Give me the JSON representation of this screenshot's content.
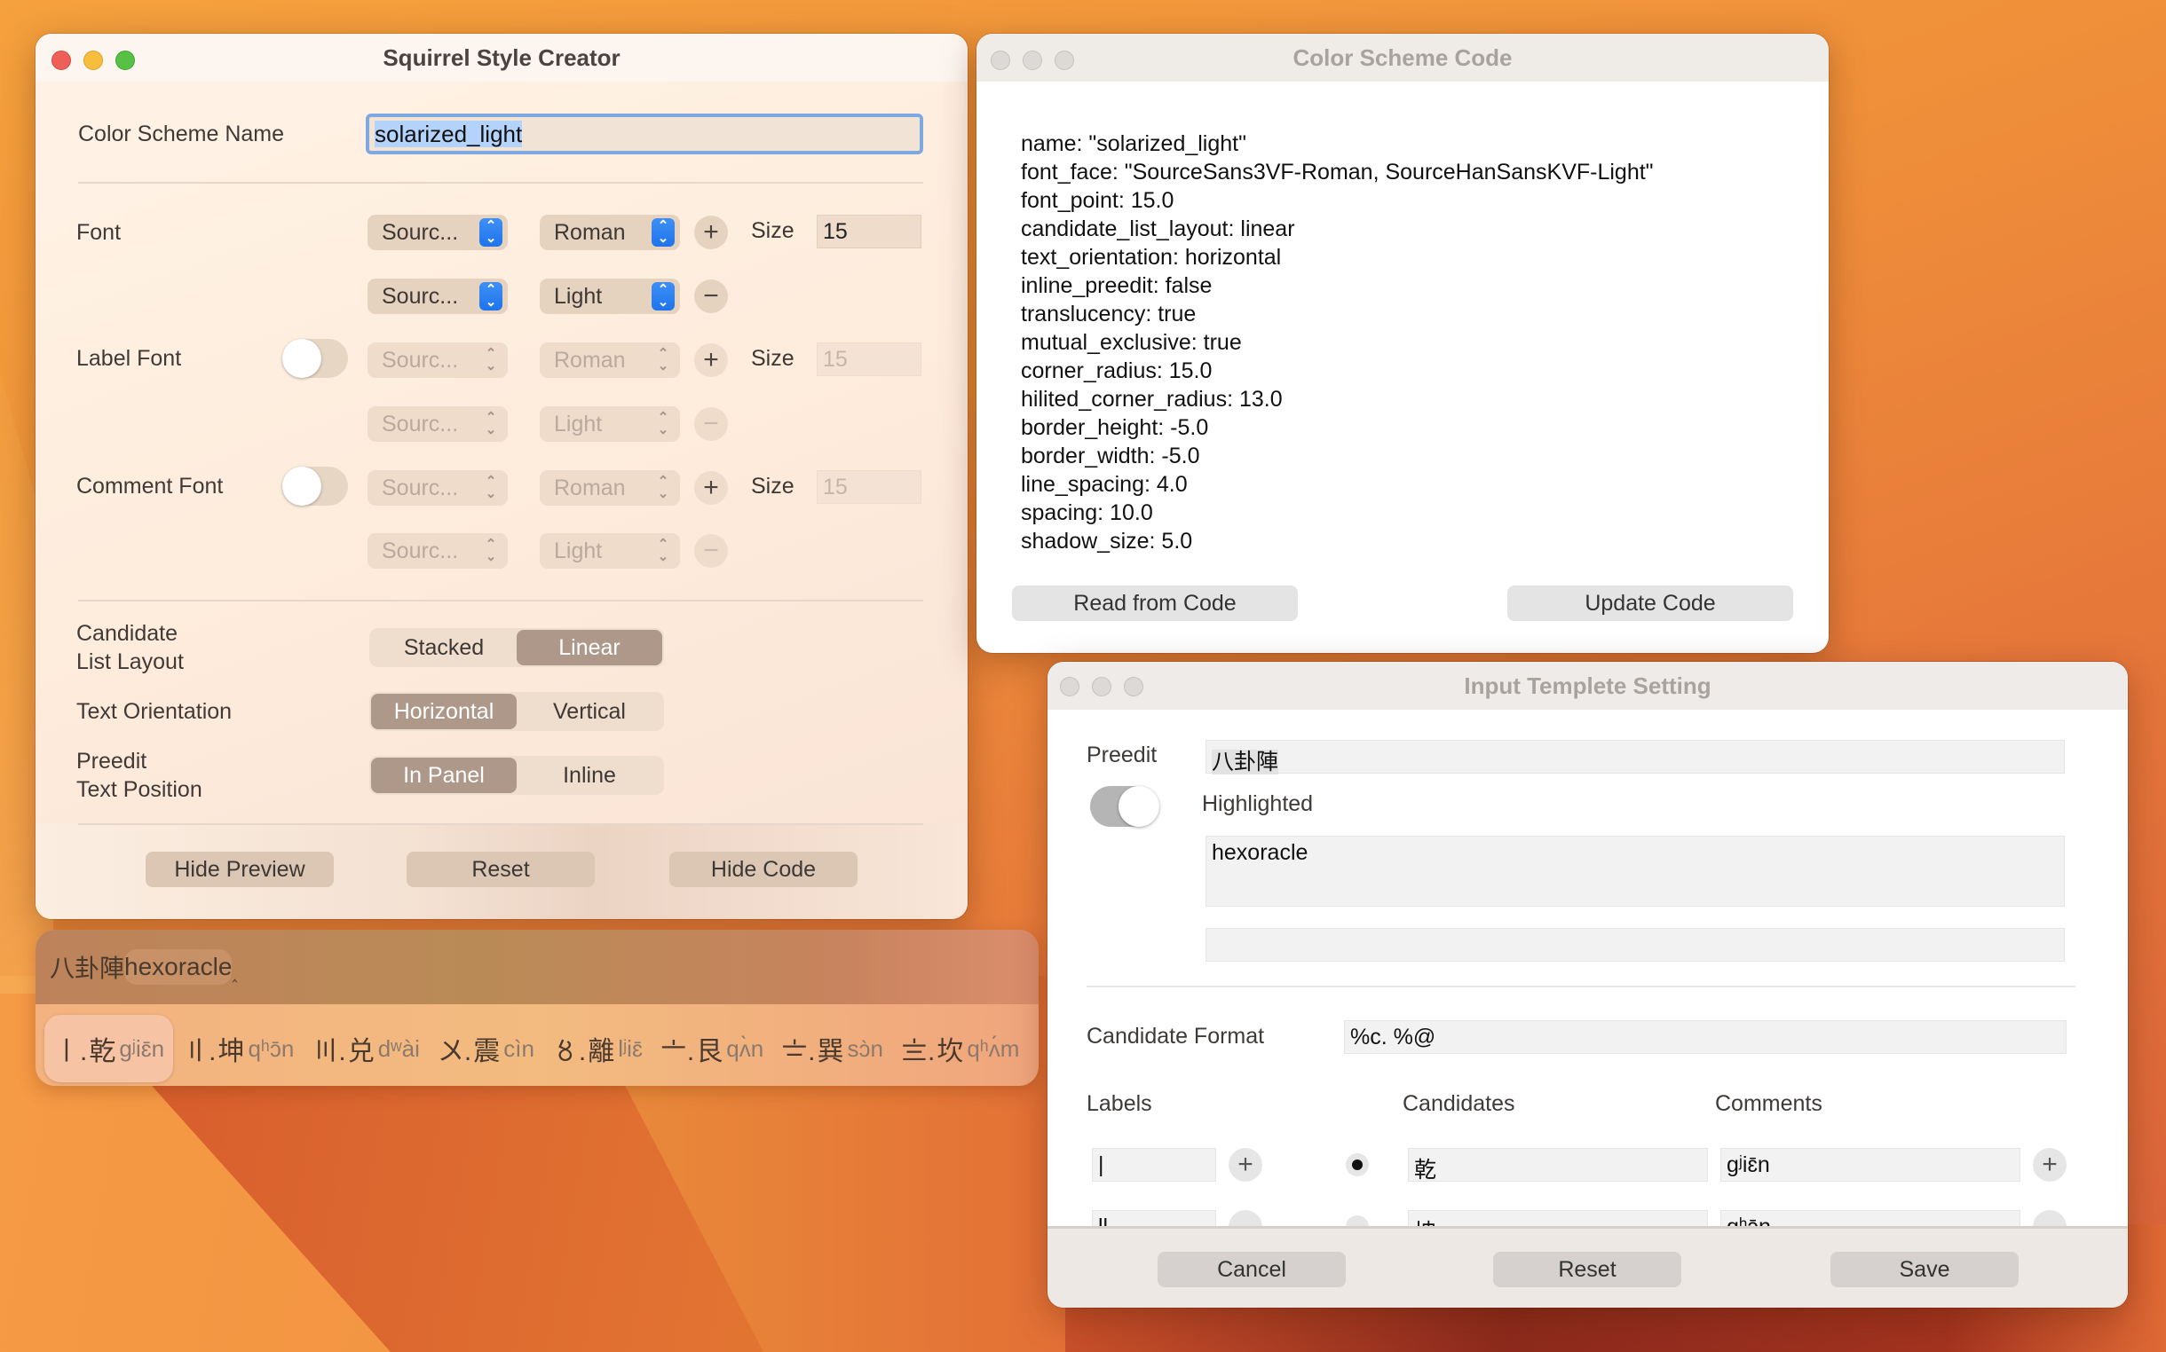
{
  "creator": {
    "title": "Squirrel Style Creator",
    "scheme_name_label": "Color Scheme Name",
    "scheme_name_value": "solarized_light",
    "font": {
      "label": "Font",
      "row1": {
        "family": "Sourc...",
        "style": "Roman",
        "size_label": "Size",
        "size": "15"
      },
      "row2": {
        "family": "Sourc...",
        "style": "Light"
      }
    },
    "label_font": {
      "label": "Label Font",
      "enabled": false,
      "row1": {
        "family": "Sourc...",
        "style": "Roman",
        "size_label": "Size",
        "size": "15"
      },
      "row2": {
        "family": "Sourc...",
        "style": "Light"
      }
    },
    "comment_font": {
      "label": "Comment Font",
      "enabled": false,
      "row1": {
        "family": "Sourc...",
        "style": "Roman",
        "size_label": "Size",
        "size": "15"
      },
      "row2": {
        "family": "Sourc...",
        "style": "Light"
      }
    },
    "candidate_layout": {
      "label_line1": "Candidate",
      "label_line2": "List Layout",
      "options": [
        "Stacked",
        "Linear"
      ],
      "selected": "Linear"
    },
    "text_orientation": {
      "label": "Text Orientation",
      "options": [
        "Horizontal",
        "Vertical"
      ],
      "selected": "Horizontal"
    },
    "preedit_position": {
      "label_line1": "Preedit",
      "label_line2": "Text Position",
      "options": [
        "In Panel",
        "Inline"
      ],
      "selected": "In Panel"
    },
    "buttons": {
      "hide_preview": "Hide Preview",
      "reset": "Reset",
      "hide_code": "Hide Code"
    }
  },
  "code_window": {
    "title": "Color Scheme Code",
    "lines": [
      "name: \"solarized_light\"",
      "font_face: \"SourceSans3VF-Roman, SourceHanSansKVF-Light\"",
      "font_point: 15.0",
      "candidate_list_layout: linear",
      "text_orientation: horizontal",
      "inline_preedit: false",
      "translucency: true",
      "mutual_exclusive: true",
      "corner_radius: 15.0",
      "hilited_corner_radius: 13.0",
      "border_height: -5.0",
      "border_width: -5.0",
      "line_spacing: 4.0",
      "spacing: 10.0",
      "shadow_size: 5.0"
    ],
    "buttons": {
      "read": "Read from Code",
      "update": "Update Code"
    }
  },
  "template_window": {
    "title": "Input Templete Setting",
    "preedit_label": "Preedit",
    "preedit_value": "八卦陣",
    "highlighted_label": "Highlighted",
    "highlighted_on": true,
    "highlighted_value": "hexoracle",
    "after_value": "",
    "candidate_format_label": "Candidate Format",
    "candidate_format_value": "%c. %@",
    "columns": {
      "labels": "Labels",
      "candidates": "Candidates",
      "comments": "Comments"
    },
    "rows": [
      {
        "label": "|",
        "candidate": "乾",
        "comment": "gʲiɛ̄n",
        "selected": true
      },
      {
        "label": "ll",
        "candidate": "坤",
        "comment": "qʰɔ̄n",
        "selected": false
      }
    ],
    "buttons": {
      "cancel": "Cancel",
      "reset": "Reset",
      "save": "Save"
    }
  },
  "preview": {
    "preedit": "八卦陣",
    "highlighted": "hexoracle",
    "caret": "‸",
    "candidates": [
      {
        "label": "〡.",
        "text": "乾",
        "comment": "gʲiɛ̄n",
        "highlighted": true
      },
      {
        "label": "〢.",
        "text": "坤",
        "comment": "qʰɔ̄n"
      },
      {
        "label": "〣.",
        "text": "兑",
        "comment": "dʷài"
      },
      {
        "label": "〤.",
        "text": "震",
        "comment": "cìn"
      },
      {
        "label": "〥.",
        "text": "離",
        "comment": "lʲiɛ̄"
      },
      {
        "label": "〦.",
        "text": "艮",
        "comment": "qʌ̀n"
      },
      {
        "label": "〧.",
        "text": "巽",
        "comment": "sɔ̀n"
      },
      {
        "label": "〨.",
        "text": "坎",
        "comment": "qʰʌ́m"
      }
    ]
  },
  "icons": {
    "plus": "+",
    "minus": "−",
    "chevron_updown_up": "⌃",
    "chevron_updown_down": "⌄"
  }
}
